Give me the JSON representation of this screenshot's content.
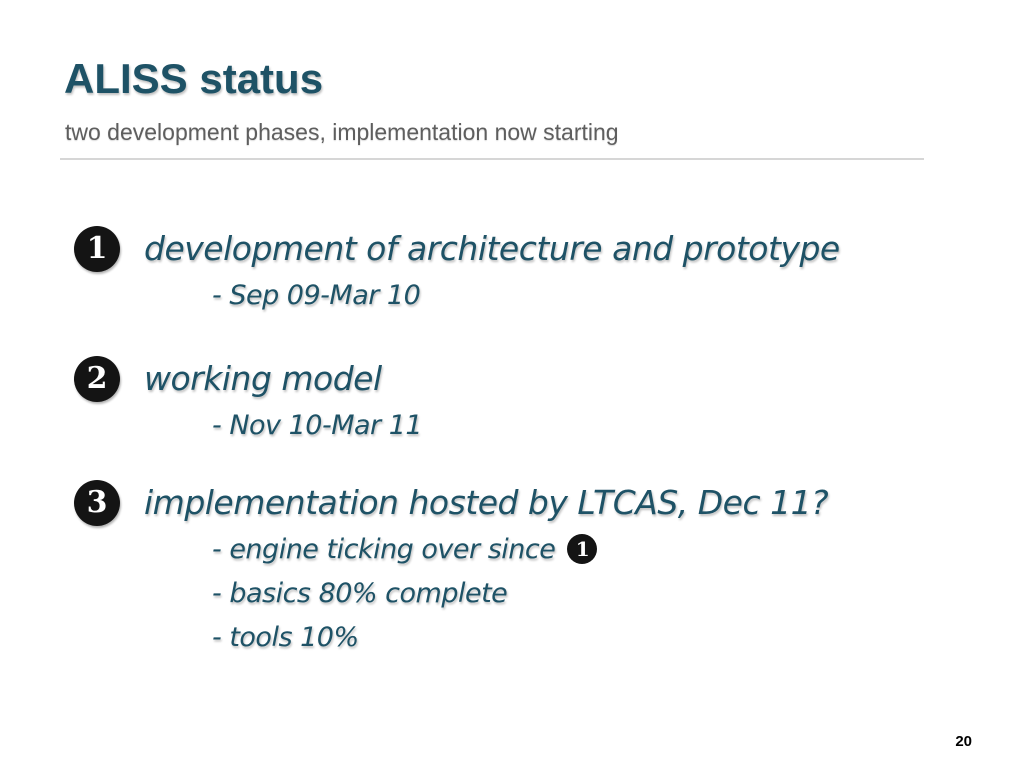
{
  "slide": {
    "title": "ALISS status",
    "subtitle": "two development phases, implementation now starting",
    "page_number": "20"
  },
  "phases": [
    {
      "number": "1",
      "label": "development of architecture and prototype",
      "details": [
        "- Sep 09-Mar 10"
      ]
    },
    {
      "number": "2",
      "label": "working model",
      "details": [
        "- Nov 10-Mar 11"
      ]
    },
    {
      "number": "3",
      "label": "implementation hosted by LTCAS, Dec 11?",
      "details": [
        "- engine ticking over since",
        "- basics 80% complete",
        "- tools 10%"
      ],
      "detail_ref_number": "1"
    }
  ],
  "colors": {
    "title": "#1e5266",
    "subtitle": "#5e5e5e",
    "bullet_circle": "#141414",
    "rule": "#d6d6d6"
  },
  "icons": {
    "phase_bullet": "dingbat-negative-circled-digit"
  }
}
